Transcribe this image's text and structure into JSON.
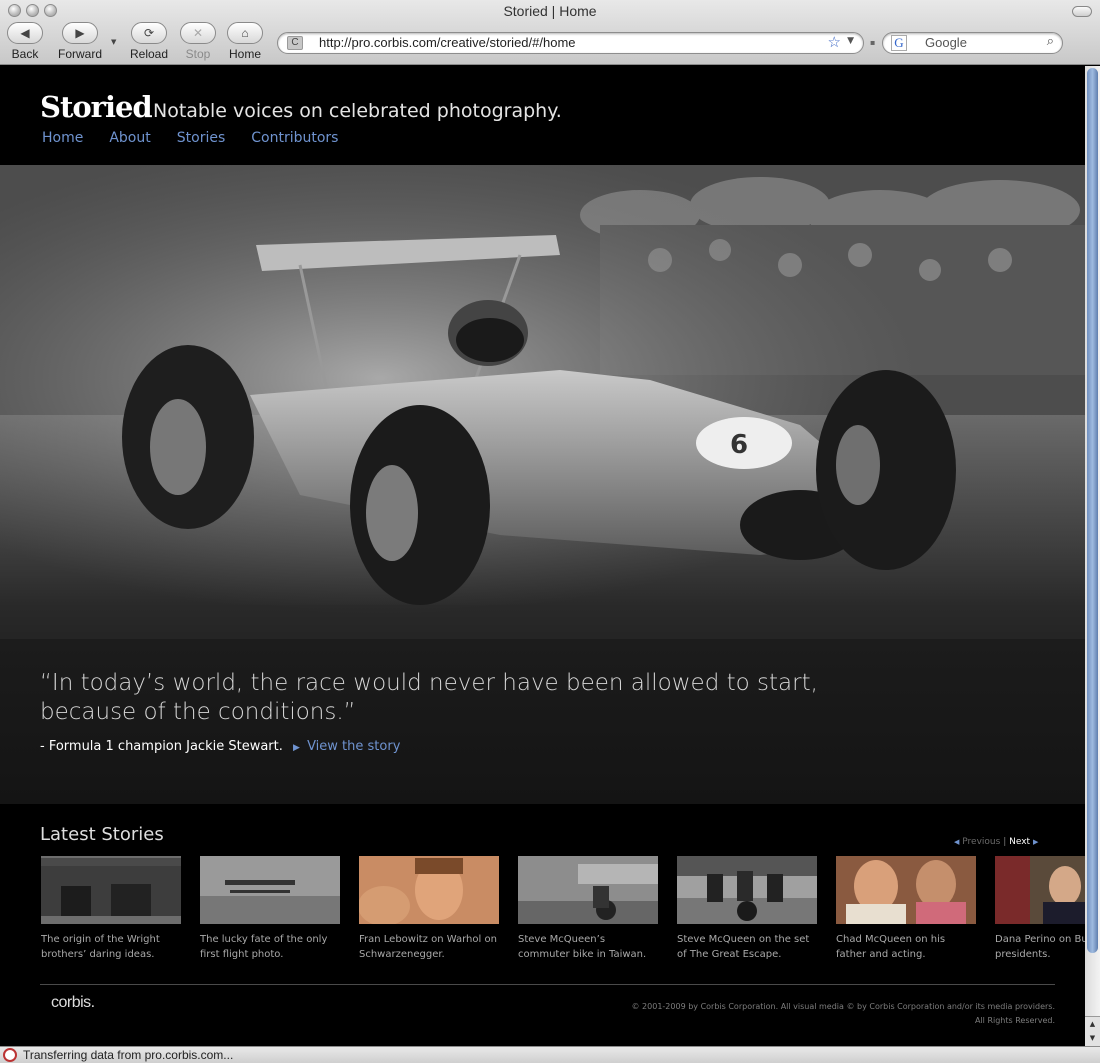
{
  "window": {
    "title": "Storied | Home"
  },
  "toolbar": {
    "back": "Back",
    "forward": "Forward",
    "reload": "Reload",
    "stop": "Stop",
    "home": "Home",
    "url": "http://pro.corbis.com/creative/storied/#/home",
    "search_placeholder": "Google"
  },
  "site": {
    "logo": "Storied",
    "tagline": "Notable voices on celebrated photography.",
    "nav": [
      "Home",
      "About",
      "Stories",
      "Contributors"
    ]
  },
  "hero": {
    "quote": "“In today’s world, the race would never have been allowed to start, because of the conditions.”",
    "attribution": "- Formula 1 champion Jackie Stewart.",
    "link": "View the story"
  },
  "latest": {
    "title": "Latest Stories",
    "previous": "Previous",
    "separator": "|",
    "next": "Next",
    "items": [
      {
        "caption": "The origin of the Wright brothers’ daring ideas."
      },
      {
        "caption": "The lucky fate of the only first flight photo."
      },
      {
        "caption": "Fran Lebowitz on Warhol on Schwarzenegger."
      },
      {
        "caption": "Steve McQueen’s commuter bike in Taiwan."
      },
      {
        "caption": "Steve McQueen on the set of The Great Escape."
      },
      {
        "caption": "Chad McQueen on his father and acting."
      },
      {
        "caption": "Dana Perino on Bush to presidents."
      }
    ]
  },
  "footer": {
    "brand": "corbis.",
    "copyright_line1": "© 2001-2009 by Corbis Corporation. All visual media © by Corbis Corporation and/or its media providers.",
    "copyright_line2": "All Rights Reserved."
  },
  "status": {
    "text": "Transferring data from pro.corbis.com..."
  }
}
